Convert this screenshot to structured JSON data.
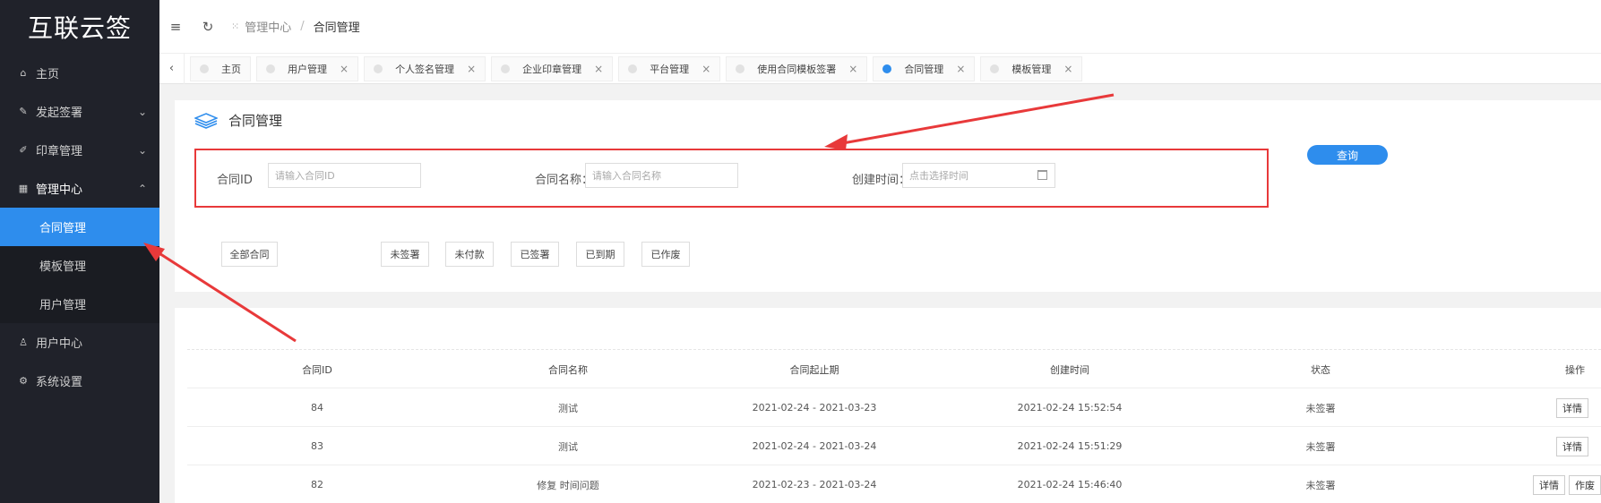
{
  "app": {
    "logo": "互联云签"
  },
  "sidebar": {
    "items": [
      {
        "label": "主页"
      },
      {
        "label": "发起签署"
      },
      {
        "label": "印章管理"
      },
      {
        "label": "管理中心"
      },
      {
        "label": "合同管理"
      },
      {
        "label": "模板管理"
      },
      {
        "label": "用户管理"
      },
      {
        "label": "用户中心"
      },
      {
        "label": "系统设置"
      }
    ]
  },
  "header": {
    "breadcrumb": {
      "parent": "管理中心",
      "separator": "/",
      "current": "合同管理"
    }
  },
  "tabs": [
    {
      "label": "主页"
    },
    {
      "label": "用户管理"
    },
    {
      "label": "个人签名管理"
    },
    {
      "label": "企业印章管理"
    },
    {
      "label": "平台管理"
    },
    {
      "label": "使用合同模板签署"
    },
    {
      "label": "合同管理"
    },
    {
      "label": "模板管理"
    }
  ],
  "page": {
    "title": "合同管理",
    "search": {
      "id_label": "合同ID",
      "id_placeholder": "请输入合同ID",
      "name_label": "合同名称：",
      "name_placeholder": "请输入合同名称",
      "time_label": "创建时间：",
      "time_placeholder": "点击选择时间",
      "query_button": "查询"
    },
    "filters": [
      "全部合同",
      "未签署",
      "未付款",
      "已签署",
      "已到期",
      "已作废"
    ],
    "table": {
      "columns": [
        "合同ID",
        "合同名称",
        "合同起止期",
        "创建时间",
        "状态",
        "操作"
      ],
      "rows": [
        {
          "id": "84",
          "name": "测试",
          "period": "2021-02-24 - 2021-03-23",
          "created": "2021-02-24 15:52:54",
          "status": "未签署",
          "ops": [
            "详情"
          ]
        },
        {
          "id": "83",
          "name": "测试",
          "period": "2021-02-24 - 2021-03-24",
          "created": "2021-02-24 15:51:29",
          "status": "未签署",
          "ops": [
            "详情"
          ]
        },
        {
          "id": "82",
          "name": "修复 时间问题",
          "period": "2021-02-23 - 2021-03-24",
          "created": "2021-02-24 15:46:40",
          "status": "未签署",
          "ops": [
            "详情",
            "作废"
          ]
        }
      ]
    }
  },
  "colors": {
    "sidebar_bg": "#20222a",
    "accent": "#2e8ded",
    "annotation": "#e8393a"
  }
}
